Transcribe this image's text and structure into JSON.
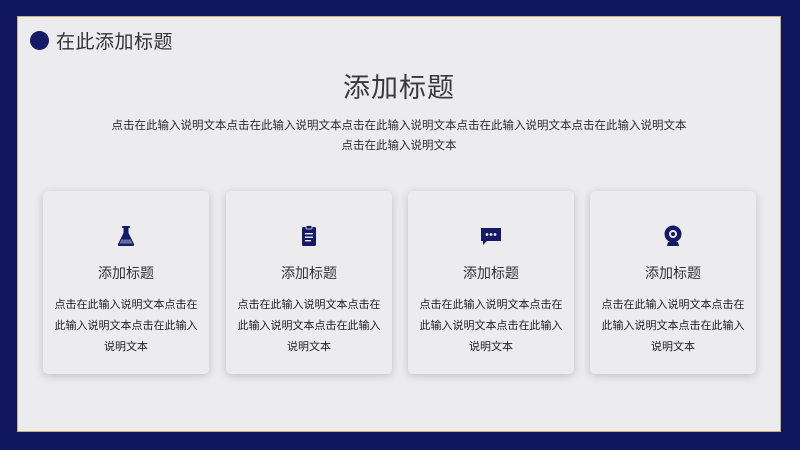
{
  "header": {
    "title": "在此添加标题"
  },
  "main": {
    "title": "添加标题",
    "intro_line1": "点击在此输入说明文本点击在此输入说明文本点击在此输入说明文本点击在此输入说明文本点击在此输入说明文本",
    "intro_line2": "点击在此输入说明文本"
  },
  "cards": [
    {
      "icon": "flask-icon",
      "title": "添加标题",
      "text": "点击在此输入说明文本点击在此输入说明文本点击在此输入说明文本"
    },
    {
      "icon": "clipboard-icon",
      "title": "添加标题",
      "text": "点击在此输入说明文本点击在此输入说明文本点击在此输入说明文本"
    },
    {
      "icon": "chat-bubble-icon",
      "title": "添加标题",
      "text": "点击在此输入说明文本点击在此输入说明文本点击在此输入说明文本"
    },
    {
      "icon": "webcam-icon",
      "title": "添加标题",
      "text": "点击在此输入说明文本点击在此输入说明文本点击在此输入说明文本"
    }
  ],
  "colors": {
    "frame": "#111660",
    "accent": "#141a66",
    "slide_bg": "#ececee",
    "border": "#c9ad78"
  }
}
